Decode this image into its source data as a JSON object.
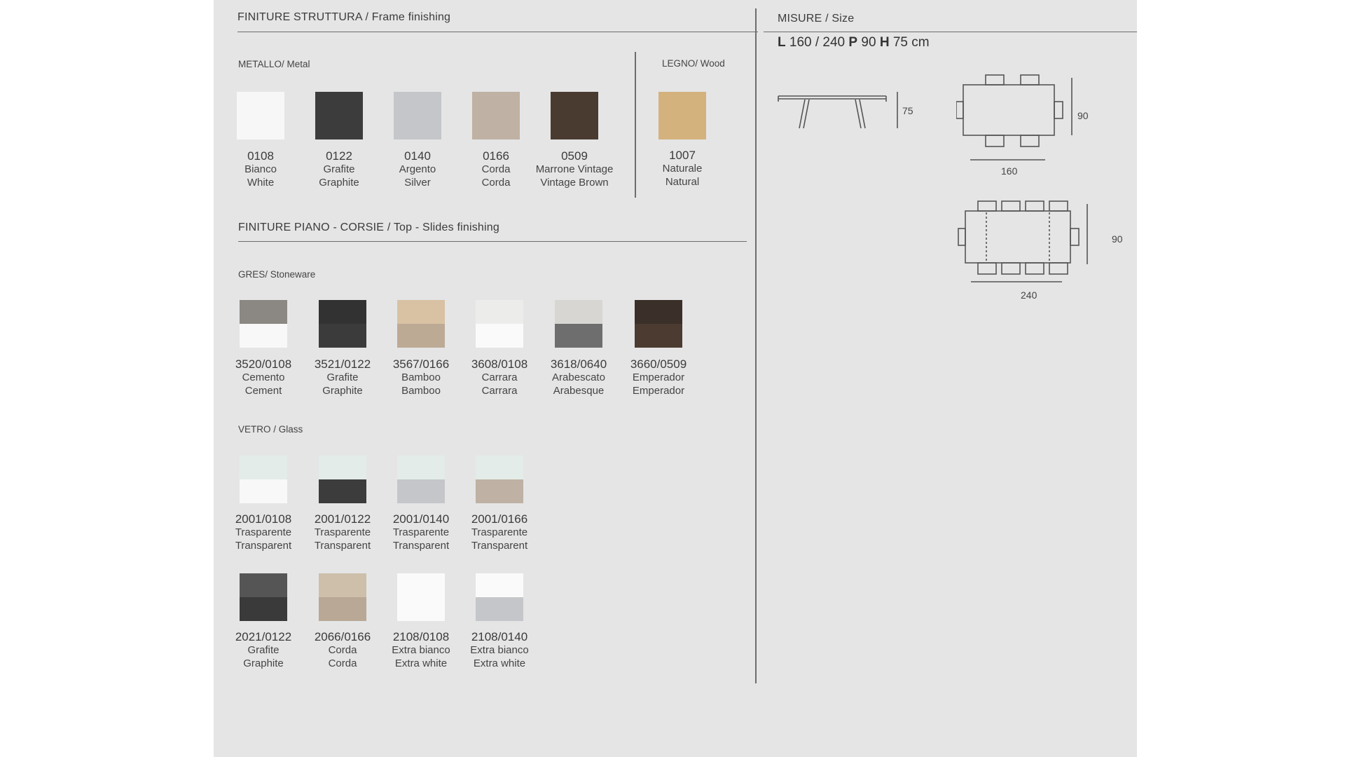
{
  "frame": {
    "title_it": "FINITURE STRUTTURA",
    "title_en": "Frame finishing",
    "metal_heading": "METALLO/ Metal",
    "wood_heading": "LEGNO/ Wood",
    "metal": [
      {
        "code": "0108",
        "it": "Bianco",
        "en": "White",
        "color": "#f7f7f7"
      },
      {
        "code": "0122",
        "it": "Grafite",
        "en": "Graphite",
        "color": "#3c3c3c"
      },
      {
        "code": "0140",
        "it": "Argento",
        "en": "Silver",
        "color": "#c4c6c9"
      },
      {
        "code": "0166",
        "it": "Corda",
        "en": "Corda",
        "color": "#bfb1a3"
      },
      {
        "code": "0509",
        "it": "Marrone Vintage",
        "en": "Vintage Brown",
        "color": "#4a3b31"
      }
    ],
    "wood": [
      {
        "code": "1007",
        "it": "Naturale",
        "en": "Natural",
        "color": "#d4b27e"
      }
    ]
  },
  "top": {
    "title_it": "FINITURE PIANO - CORSIE",
    "title_en": "Top - Slides finishing",
    "stoneware_heading": "GRES/ Stoneware",
    "glass_heading": "VETRO / Glass",
    "stoneware": [
      {
        "code": "3520/0108",
        "it": "Cemento",
        "en": "Cement",
        "top_color": "#8b8783",
        "bottom_color": "#f8f8f8"
      },
      {
        "code": "3521/0122",
        "it": "Grafite",
        "en": "Graphite",
        "top_color": "#323232",
        "bottom_color": "#3b3b3b"
      },
      {
        "code": "3567/0166",
        "it": "Bamboo",
        "en": "Bamboo",
        "top_color": "#d8c2a3",
        "bottom_color": "#bdaa95"
      },
      {
        "code": "3608/0108",
        "it": "Carrara",
        "en": "Carrara",
        "top_color": "#ecedeb",
        "bottom_color": "#fafafa"
      },
      {
        "code": "3618/0640",
        "it": "Arabescato",
        "en": "Arabesque",
        "top_color": "#d8d6d2",
        "bottom_color": "#6e6e6e"
      },
      {
        "code": "3660/0509",
        "it": "Emperador",
        "en": "Emperador",
        "top_color": "#3a2f29",
        "bottom_color": "#4c3b30"
      }
    ],
    "glass_row1": [
      {
        "code": "2001/0108",
        "it": "Trasparente",
        "en": "Transparent",
        "top_color": "#e3ece8",
        "bottom_color": "#f8f8f8"
      },
      {
        "code": "2001/0122",
        "it": "Trasparente",
        "en": "Transparent",
        "top_color": "#e3ece8",
        "bottom_color": "#3c3c3c"
      },
      {
        "code": "2001/0140",
        "it": "Trasparente",
        "en": "Transparent",
        "top_color": "#e3ece8",
        "bottom_color": "#c4c6c9"
      },
      {
        "code": "2001/0166",
        "it": "Trasparente",
        "en": "Transparent",
        "top_color": "#e3ece8",
        "bottom_color": "#bfb1a3"
      }
    ],
    "glass_row2": [
      {
        "code": "2021/0122",
        "it": "Grafite",
        "en": "Graphite",
        "top_color": "#555555",
        "bottom_color": "#3a3a3a"
      },
      {
        "code": "2066/0166",
        "it": "Corda",
        "en": "Corda",
        "top_color": "#cdbfa9",
        "bottom_color": "#b9a896"
      },
      {
        "code": "2108/0108",
        "it": "Extra bianco",
        "en": "Extra white",
        "top_color": "#fafafa",
        "bottom_color": "#fafafa"
      },
      {
        "code": "2108/0140",
        "it": "Extra bianco",
        "en": "Extra white",
        "top_color": "#fafafa",
        "bottom_color": "#c4c6c9"
      }
    ]
  },
  "size": {
    "title_it": "MISURE",
    "title_en": "Size",
    "line": {
      "L_key": "L",
      "L_val": "160 / 240",
      "P_key": "P",
      "P_val": "90",
      "H_key": "H",
      "H_val": "75 cm"
    },
    "side_height": "75",
    "small_length": "160",
    "small_depth": "90",
    "large_length": "240",
    "large_depth": "90"
  }
}
